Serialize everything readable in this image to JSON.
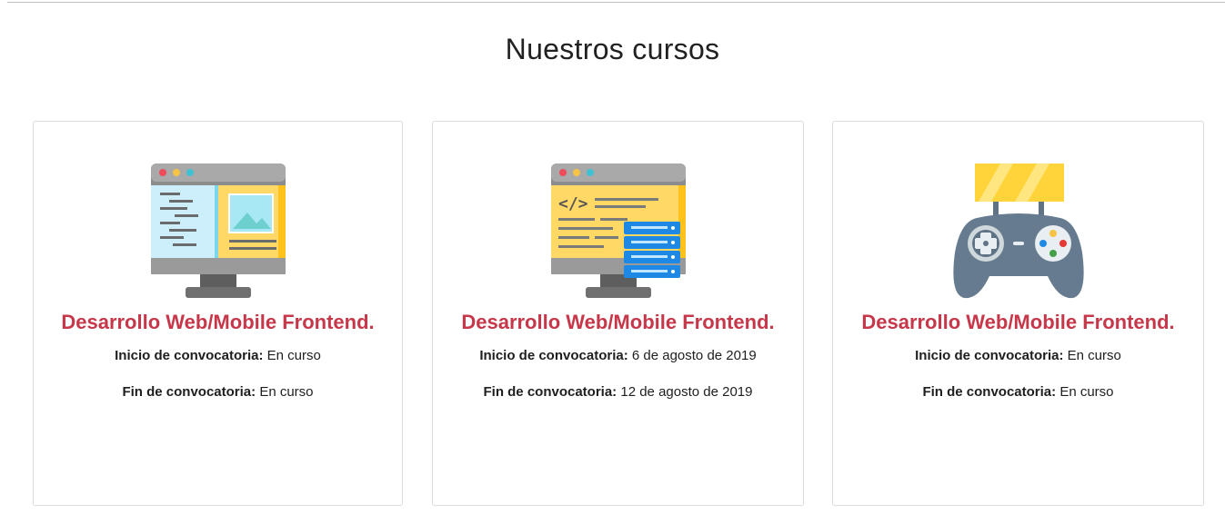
{
  "section": {
    "title": "Nuestros cursos"
  },
  "courses": [
    {
      "icon": "web-frontend-monitor-icon",
      "title": "Desarrollo Web/Mobile Frontend.",
      "start_label": "Inicio de convocatoria:",
      "start_value": "En curso",
      "end_label": "Fin de convocatoria:",
      "end_value": "En curso"
    },
    {
      "icon": "code-server-monitor-icon",
      "title": "Desarrollo Web/Mobile Frontend.",
      "start_label": "Inicio de convocatoria:",
      "start_value": "6 de agosto de 2019",
      "end_label": "Fin de convocatoria:",
      "end_value": "12 de agosto de 2019"
    },
    {
      "icon": "gamepad-icon",
      "title": "Desarrollo Web/Mobile Frontend.",
      "start_label": "Inicio de convocatoria:",
      "start_value": "En curso",
      "end_label": "Fin de convocatoria:",
      "end_value": "En curso"
    }
  ],
  "colors": {
    "course_title": "#c7374a",
    "card_border": "#dcdcdc"
  }
}
